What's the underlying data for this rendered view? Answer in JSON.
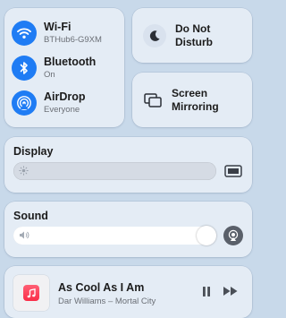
{
  "connectivity": {
    "wifi": {
      "title": "Wi-Fi",
      "subtitle": "BTHub6-G9XM",
      "icon": "wifi-icon"
    },
    "bluetooth": {
      "title": "Bluetooth",
      "subtitle": "On",
      "icon": "bluetooth-icon"
    },
    "airdrop": {
      "title": "AirDrop",
      "subtitle": "Everyone",
      "icon": "airdrop-icon"
    }
  },
  "do_not_disturb": {
    "line1": "Do Not",
    "line2": "Disturb",
    "icon": "moon-icon"
  },
  "screen_mirroring": {
    "line1": "Screen",
    "line2": "Mirroring",
    "icon": "screen-mirroring-icon"
  },
  "display": {
    "title": "Display",
    "brightness_level": 0.0,
    "icon": "display-icon"
  },
  "sound": {
    "title": "Sound",
    "volume_level": 1.0,
    "icon": "airplay-audio-icon"
  },
  "now_playing": {
    "track": "As Cool As I Am",
    "artist_album": "Dar Williams – Mortal City",
    "app_icon": "music-icon"
  },
  "colors": {
    "accent": "#1f7cf4",
    "music": "#fa2d48"
  }
}
